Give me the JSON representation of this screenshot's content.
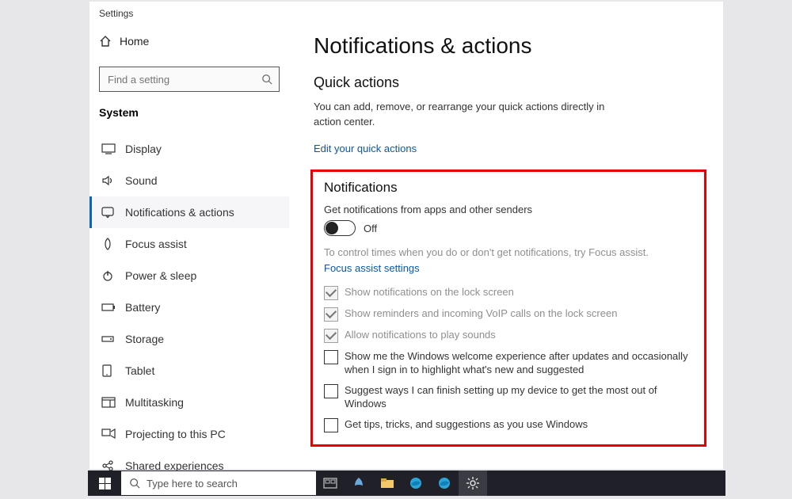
{
  "window_title": "Settings",
  "home_label": "Home",
  "search_placeholder": "Find a setting",
  "section_label": "System",
  "nav": [
    {
      "label": "Display",
      "icon": "display-icon"
    },
    {
      "label": "Sound",
      "icon": "sound-icon"
    },
    {
      "label": "Notifications & actions",
      "icon": "notifications-icon"
    },
    {
      "label": "Focus assist",
      "icon": "focus-icon"
    },
    {
      "label": "Power & sleep",
      "icon": "power-icon"
    },
    {
      "label": "Battery",
      "icon": "battery-icon"
    },
    {
      "label": "Storage",
      "icon": "storage-icon"
    },
    {
      "label": "Tablet",
      "icon": "tablet-icon"
    },
    {
      "label": "Multitasking",
      "icon": "multitask-icon"
    },
    {
      "label": "Projecting to this PC",
      "icon": "project-icon"
    },
    {
      "label": "Shared experiences",
      "icon": "shared-icon"
    }
  ],
  "main": {
    "h1": "Notifications & actions",
    "h2": "Quick actions",
    "desc": "You can add, remove, or rearrange your quick actions directly in action center.",
    "link1": "Edit your quick actions",
    "h3": "Notifications",
    "sub1": "Get notifications from apps and other senders",
    "toggle_state": "Off",
    "grey": "To control times when you do or don't get notifications, try Focus assist.",
    "link2": "Focus assist settings",
    "checks": [
      {
        "label": "Show notifications on the lock screen",
        "checked": true,
        "disabled": true
      },
      {
        "label": "Show reminders and incoming VoIP calls on the lock screen",
        "checked": true,
        "disabled": true
      },
      {
        "label": "Allow notifications to play sounds",
        "checked": true,
        "disabled": true
      },
      {
        "label": "Show me the Windows welcome experience after updates and occasionally when I sign in to highlight what's new and suggested",
        "checked": false,
        "disabled": false
      },
      {
        "label": "Suggest ways I can finish setting up my device to get the most out of Windows",
        "checked": false,
        "disabled": false
      },
      {
        "label": "Get tips, tricks, and suggestions as you use Windows",
        "checked": false,
        "disabled": false
      }
    ]
  },
  "taskbar": {
    "search": "Type here to search"
  },
  "colors": {
    "accent": "#0a58a6",
    "highlight": "#e60000"
  }
}
